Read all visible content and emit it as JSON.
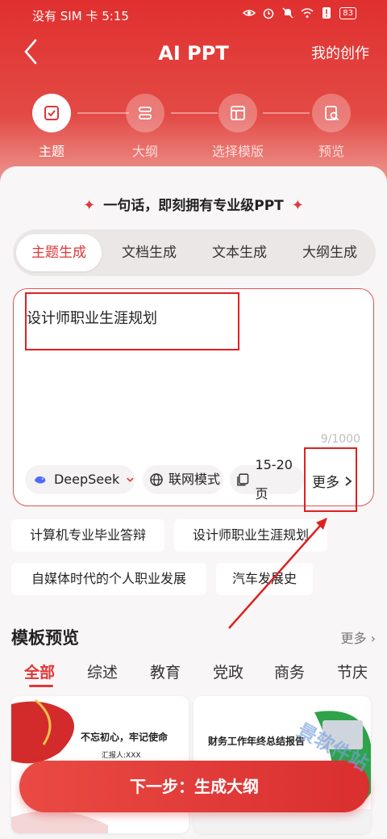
{
  "status_bar": {
    "text": "没有 SIM 卡 5:15",
    "battery": "83"
  },
  "nav": {
    "title": "AI PPT",
    "right_action": "我的创作"
  },
  "steps": [
    {
      "label": "主题",
      "icon": "topic-icon",
      "active": true
    },
    {
      "label": "大纲",
      "icon": "outline-icon",
      "active": false
    },
    {
      "label": "选择模版",
      "icon": "template-icon",
      "active": false
    },
    {
      "label": "预览",
      "icon": "preview-icon",
      "active": false
    }
  ],
  "slogan": "一句话，即刻拥有专业级PPT",
  "tabs": [
    "主题生成",
    "文档生成",
    "文本生成",
    "大纲生成"
  ],
  "input": {
    "value": "设计师职业生涯规划",
    "char_count": "9/1000",
    "model": "DeepSeek",
    "web_mode": "联网模式",
    "pages": "15-20页",
    "more": "更多"
  },
  "suggestions": [
    "计算机专业毕业答辩",
    "设计师职业生涯规划",
    "自媒体时代的个人职业发展",
    "汽车发展史"
  ],
  "templates_section": {
    "title": "模板预览",
    "more": "更多",
    "categories": [
      "全部",
      "综述",
      "教育",
      "党政",
      "商务",
      "节庆"
    ],
    "cards": [
      {
        "title": "不忘初心，牢记使命",
        "subtitle": "汇报人:XXX"
      },
      {
        "title": "财务工作年终总结报告",
        "subtitle": ""
      }
    ]
  },
  "next_button": "下一步：生成大纲",
  "watermark": "景软件站",
  "colors": {
    "accent": "#e13535",
    "annotation": "#e02020"
  }
}
